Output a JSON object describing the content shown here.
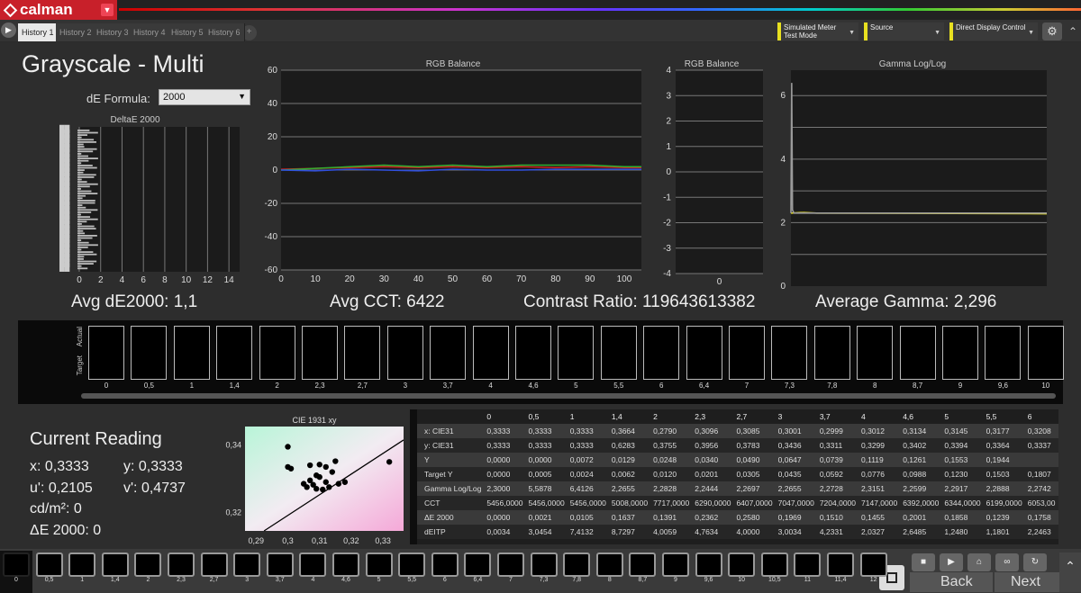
{
  "app": {
    "logo_text": "calman"
  },
  "tabs": [
    "History 1",
    "History 2",
    "History 3",
    "History 4",
    "History 5",
    "History 6"
  ],
  "toolbar": {
    "meter": {
      "line1": "Simulated Meter",
      "line2": "Test Mode"
    },
    "source": "Source",
    "display": "Direct Display Control"
  },
  "page_title": "Grayscale - Multi",
  "de_formula": {
    "label": "dE Formula:",
    "value": "2000"
  },
  "stats": {
    "avg_de": "Avg dE2000: 1,1",
    "avg_cct": "Avg CCT: 6422",
    "contrast": "Contrast Ratio: 119643613382",
    "avg_gamma": "Average Gamma: 2,296"
  },
  "chart_data": [
    {
      "type": "bar",
      "title": "DeltaE 2000",
      "x_ticks": [
        "0",
        "2",
        "4",
        "6",
        "8",
        "10",
        "12",
        "14"
      ],
      "xlim": [
        0,
        15
      ],
      "orientation": "horizontal",
      "note_values": "many stacked near-zero bars with overlapping unreadable labels"
    },
    {
      "type": "line",
      "title": "RGB Balance",
      "x_ticks": [
        "0",
        "10",
        "20",
        "30",
        "40",
        "50",
        "60",
        "70",
        "80",
        "90",
        "100"
      ],
      "y_ticks": [
        "60",
        "40",
        "20",
        "0",
        "-20",
        "-40",
        "-60"
      ],
      "xlim": [
        0,
        105
      ],
      "ylim": [
        -60,
        60
      ],
      "series": [
        {
          "color": "#d02020",
          "x": [
            0,
            10,
            20,
            30,
            40,
            50,
            60,
            70,
            80,
            90,
            100,
            105
          ],
          "values": [
            0.5,
            1,
            1.5,
            2,
            1.5,
            2,
            1.5,
            2,
            1.5,
            2,
            1.5,
            1.5
          ]
        },
        {
          "color": "#30b030",
          "x": [
            0,
            10,
            20,
            30,
            40,
            50,
            60,
            70,
            80,
            90,
            100,
            105
          ],
          "values": [
            0,
            1,
            2,
            3,
            2,
            3,
            2,
            3,
            3,
            3,
            2,
            2
          ]
        },
        {
          "color": "#3050e0",
          "x": [
            0,
            10,
            20,
            30,
            40,
            50,
            60,
            70,
            80,
            90,
            100,
            105
          ],
          "values": [
            0,
            -0.5,
            0.5,
            0,
            -0.5,
            0.5,
            0,
            0,
            0.5,
            0.5,
            0.5,
            0.5
          ]
        }
      ]
    },
    {
      "type": "bar",
      "title": "RGB Balance",
      "x_ticks": [
        "0"
      ],
      "y_ticks": [
        "4",
        "3",
        "2",
        "1",
        "0",
        "-1",
        "-2",
        "-3",
        "-4"
      ],
      "ylim": [
        -4,
        4
      ]
    },
    {
      "type": "line",
      "title": "Gamma Log/Log",
      "y_ticks": [
        "6",
        "4",
        "2",
        "0"
      ],
      "ylim": [
        0,
        6.8
      ],
      "series": [
        {
          "color": "#e8e020",
          "x": [
            0,
            0.05,
            0.1,
            1
          ],
          "values": [
            2.3,
            2.32,
            2.3,
            2.28
          ]
        },
        {
          "color": "#9a9a9a",
          "x": [
            0,
            0.003,
            0.006,
            0.012,
            1
          ],
          "values": [
            2.3,
            6.4,
            2.4,
            2.3,
            2.3
          ]
        }
      ]
    },
    {
      "type": "scatter",
      "title": "CIE 1931 xy",
      "x_ticks": [
        "0,29",
        "0,3",
        "0,31",
        "0,32",
        "0,33"
      ],
      "y_ticks": [
        "0,34",
        "0,32"
      ],
      "xlim": [
        0.2865,
        0.3365
      ],
      "ylim": [
        0.3145,
        0.3455
      ],
      "points": [
        [
          0.3,
          0.3395
        ],
        [
          0.3,
          0.3335
        ],
        [
          0.301,
          0.333
        ],
        [
          0.332,
          0.335
        ],
        [
          0.307,
          0.334
        ],
        [
          0.31,
          0.3342
        ],
        [
          0.312,
          0.3335
        ],
        [
          0.315,
          0.3352
        ],
        [
          0.31,
          0.3305
        ],
        [
          0.312,
          0.329
        ],
        [
          0.308,
          0.3282
        ],
        [
          0.306,
          0.3275
        ],
        [
          0.309,
          0.327
        ],
        [
          0.311,
          0.3268
        ],
        [
          0.313,
          0.3275
        ],
        [
          0.316,
          0.3285
        ],
        [
          0.318,
          0.329
        ],
        [
          0.314,
          0.332
        ],
        [
          0.309,
          0.331
        ],
        [
          0.307,
          0.3295
        ],
        [
          0.305,
          0.3285
        ]
      ]
    }
  ],
  "swatches": [
    "0",
    "0,5",
    "1",
    "1,4",
    "2",
    "2,3",
    "2,7",
    "3",
    "3,7",
    "4",
    "4,6",
    "5",
    "5,5",
    "6",
    "6,4",
    "7",
    "7,3",
    "7,8",
    "8",
    "8,7",
    "9",
    "9,6",
    "10"
  ],
  "swatch_row_labels": {
    "actual": "Actual",
    "target": "Target"
  },
  "current_reading": {
    "title": "Current Reading",
    "x": "x: 0,3333",
    "y": "y: 0,3333",
    "u": "u': 0,2105",
    "v": "v': 0,4737",
    "cd": "cd/m²: 0",
    "de": "ΔE 2000: 0"
  },
  "table": {
    "columns": [
      "0",
      "0,5",
      "1",
      "1,4",
      "2",
      "2,3",
      "2,7",
      "3",
      "3,7",
      "4",
      "4,6",
      "5",
      "5,5",
      "6"
    ],
    "rows": [
      {
        "label": "x: CIE31",
        "values": [
          "0,3333",
          "0,3333",
          "0,3333",
          "0,3664",
          "0,2790",
          "0,3096",
          "0,3085",
          "0,3001",
          "0,2999",
          "0,3012",
          "0,3134",
          "0,3145",
          "0,3177",
          "0,3208"
        ]
      },
      {
        "label": "y: CIE31",
        "values": [
          "0,3333",
          "0,3333",
          "0,3333",
          "0,6283",
          "0,3755",
          "0,3956",
          "0,3783",
          "0,3436",
          "0,3311",
          "0,3299",
          "0,3402",
          "0,3394",
          "0,3364",
          "0,3337"
        ]
      },
      {
        "label": "Y",
        "values": [
          "0,0000",
          "0,0000",
          "0,0072",
          "0,0129",
          "0,0248",
          "0,0340",
          "0,0490",
          "0,0647",
          "0,0739",
          "0,1119",
          "0,1261",
          "0,1553",
          "0,1944",
          ""
        ]
      },
      {
        "label": "Target Y",
        "values": [
          "0,0000",
          "0,0005",
          "0,0024",
          "0,0062",
          "0,0120",
          "0,0201",
          "0,0305",
          "0,0435",
          "0,0592",
          "0,0776",
          "0,0988",
          "0,1230",
          "0,1503",
          "0,1807"
        ]
      },
      {
        "label": "Gamma Log/Log",
        "values": [
          "2,3000",
          "5,5878",
          "6,4126",
          "2,2655",
          "2,2828",
          "2,2444",
          "2,2697",
          "2,2655",
          "2,2728",
          "2,3151",
          "2,2599",
          "2,2917",
          "2,2888",
          "2,2742"
        ]
      },
      {
        "label": "CCT",
        "values": [
          "5456,0000",
          "5456,0000",
          "5456,0000",
          "5008,0000",
          "7717,0000",
          "6290,0000",
          "6407,0000",
          "7047,0000",
          "7204,0000",
          "7147,0000",
          "6392,0000",
          "6344,0000",
          "6199,0000",
          "6053,00"
        ]
      },
      {
        "label": "ΔE 2000",
        "values": [
          "0,0000",
          "0,0021",
          "0,0105",
          "0,1637",
          "0,1391",
          "0,2362",
          "0,2580",
          "0,1969",
          "0,1510",
          "0,1455",
          "0,2001",
          "0,1858",
          "0,1239",
          "0,1758"
        ]
      },
      {
        "label": "dEITP",
        "values": [
          "0,0034",
          "3,0454",
          "7,4132",
          "8,7297",
          "4,0059",
          "4,7634",
          "4,0000",
          "3,0034",
          "4,2331",
          "2,0327",
          "2,6485",
          "1,2480",
          "1,1801",
          "2,2463"
        ]
      }
    ]
  },
  "bottom_patches": [
    "0",
    "0,5",
    "1",
    "1,4",
    "2",
    "2,3",
    "2,7",
    "3",
    "3,7",
    "4",
    "4,6",
    "5",
    "5,5",
    "6",
    "6,4",
    "7",
    "7,3",
    "7,8",
    "8",
    "8,7",
    "9",
    "9,6",
    "10",
    "10,5",
    "11",
    "11,4",
    "12"
  ],
  "nav": {
    "back": "Back",
    "next": "Next"
  }
}
